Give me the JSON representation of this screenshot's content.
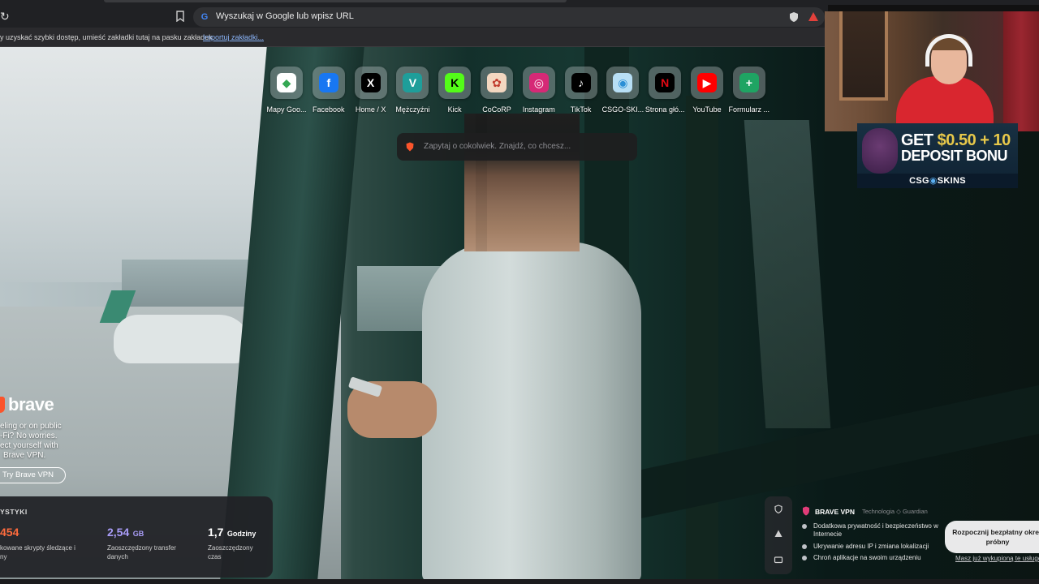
{
  "browser": {
    "url_placeholder": "Wyszukaj w Google lub wpisz URL",
    "reload_glyph": "↻",
    "google_letter": "G"
  },
  "bookmarks_bar": {
    "message": "y uzyskać szybki dostęp, umieść zakładki tutaj na pasku zakładek.",
    "import_link": "Importuj zakładki..."
  },
  "top_sites": [
    {
      "label": "Mapy Goo...",
      "icon": "maps-icon",
      "glyph": "◆",
      "bg": "#ffffff",
      "color": "#34a853"
    },
    {
      "label": "Facebook",
      "icon": "facebook-icon",
      "glyph": "f",
      "bg": "#1877f2",
      "color": "#ffffff"
    },
    {
      "label": "Home / X",
      "icon": "x-icon",
      "glyph": "X",
      "bg": "#000000",
      "color": "#ffffff"
    },
    {
      "label": "Mężczyźni",
      "icon": "v-icon",
      "glyph": "V",
      "bg": "#1e9e9a",
      "color": "#ffffff"
    },
    {
      "label": "Kick",
      "icon": "kick-icon",
      "glyph": "K",
      "bg": "#53fc18",
      "color": "#000000"
    },
    {
      "label": "CoCoRP",
      "icon": "cocorp-icon",
      "glyph": "✿",
      "bg": "#f3d7c0",
      "color": "#c0392b"
    },
    {
      "label": "Instagram",
      "icon": "instagram-icon",
      "glyph": "◎",
      "bg": "#d62976",
      "color": "#ffffff"
    },
    {
      "label": "TikTok",
      "icon": "tiktok-icon",
      "glyph": "♪",
      "bg": "#000000",
      "color": "#ffffff"
    },
    {
      "label": "CSGO-SKI...",
      "icon": "csgoskins-icon",
      "glyph": "◉",
      "bg": "#b8dff5",
      "color": "#2b8fd6"
    },
    {
      "label": "Strona głó...",
      "icon": "netflix-icon",
      "glyph": "N",
      "bg": "#000000",
      "color": "#e50914"
    },
    {
      "label": "YouTube",
      "icon": "youtube-icon",
      "glyph": "▶",
      "bg": "#ff0000",
      "color": "#ffffff"
    },
    {
      "label": "Formularz ...",
      "icon": "forms-plus-icon",
      "glyph": "+",
      "bg": "#1fa463",
      "color": "#ffffff"
    }
  ],
  "leo_search": {
    "placeholder": "Zapytaj o cokolwiek. Znajdź, co chcesz..."
  },
  "vpn_promo": {
    "brand": "brave",
    "line1": "eling or on public",
    "line2": "-Fi? No worries.",
    "line3": "ect yourself with",
    "line4": "Brave VPN.",
    "button": "Try Brave VPN"
  },
  "stats": {
    "title": "YSTYKI",
    "trackers_value": "454",
    "trackers_desc1": "kowane skrypty śledzące i",
    "trackers_desc2": "ny",
    "bandwidth_value": "2,54",
    "bandwidth_unit": "GB",
    "bandwidth_desc1": "Zaoszczędzony transfer",
    "bandwidth_desc2": "danych",
    "time_value": "1,7",
    "time_unit": "Godziny",
    "time_desc1": "Zaoszczędzony",
    "time_desc2": "czas",
    "colors": {
      "trackers": "#ff6b3d",
      "bandwidth": "#a99cf8",
      "time": "#ffffff"
    }
  },
  "vpn_card": {
    "title": "BRAVE VPN",
    "tech": "Technologia  ◇ Guardian",
    "features": [
      "Dodatkowa prywatność i bezpieczeństwo w Internecie",
      "Ukrywanie adresu IP i zmiana lokalizacji",
      "Chroń aplikacje na swoim urządzeniu"
    ],
    "trial_button": "Rozpocznij bezpłatny okres próbny",
    "redeem_link": "Masz już wykupioną te usługę?"
  },
  "ad": {
    "line1_prefix": "GET ",
    "line1_amount": "$0.50 + 10",
    "line2": "DEPOSIT BONU",
    "brand_left": "CSG",
    "brand_mid": "◉",
    "brand_right": "SKINS"
  }
}
